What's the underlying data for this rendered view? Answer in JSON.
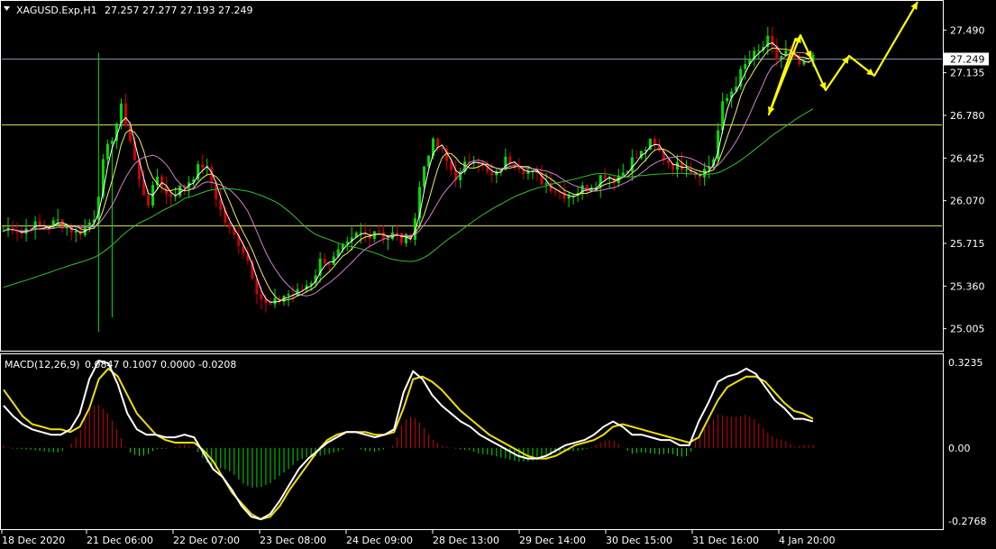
{
  "header": {
    "symbol": "XAGUSD.Exp,H1",
    "ohlc": "27.257 27.277 27.193 27.249"
  },
  "indicator": {
    "title": "MACD(12,26,9)",
    "values": "0.0847 0.1007 0.0000 -0.0208"
  },
  "colors": {
    "background": "#000000",
    "bull": "#00e000",
    "bear": "#d00000",
    "ma_white": "#ffffff",
    "ma_yellow": "#f0f060",
    "ma_violet": "#d080d0",
    "ma_green": "#30c030",
    "level_line": "#e0e060",
    "arrow": "#ffff00",
    "current_price_line": "#7f93a8"
  },
  "chart_data": [
    {
      "type": "candlestick",
      "title": "XAGUSD.Exp,H1",
      "y_ticks": [
        "27.490",
        "27.135",
        "26.780",
        "26.425",
        "26.070",
        "25.715",
        "25.360",
        "25.005"
      ],
      "ylim": [
        24.95,
        27.65
      ],
      "current_price": "27.249",
      "x_ticks": [
        "18 Dec 2020",
        "21 Dec 06:00",
        "22 Dec 07:00",
        "23 Dec 08:00",
        "24 Dec 09:00",
        "28 Dec 13:00",
        "29 Dec 14:00",
        "30 Dec 15:00",
        "31 Dec 16:00",
        "4 Jan 20:00"
      ],
      "horizontal_levels": [
        26.7,
        25.86
      ],
      "close_path": [
        25.82,
        25.86,
        25.8,
        25.88,
        25.84,
        25.86,
        25.9,
        25.86,
        25.8,
        25.84,
        25.95,
        26.4,
        26.62,
        26.85,
        26.55,
        26.2,
        26.05,
        26.3,
        26.1,
        26.15,
        26.2,
        26.3,
        26.38,
        26.2,
        25.95,
        25.8,
        25.72,
        25.55,
        25.3,
        25.18,
        25.22,
        25.3,
        25.28,
        25.35,
        25.42,
        25.6,
        25.55,
        25.65,
        25.7,
        25.8,
        25.78,
        25.85,
        25.75,
        25.8,
        25.72,
        25.82,
        26.3,
        26.55,
        26.5,
        26.35,
        26.25,
        26.4,
        26.45,
        26.3,
        26.25,
        26.4,
        26.42,
        26.35,
        26.3,
        26.25,
        26.2,
        26.15,
        26.12,
        26.15,
        26.18,
        26.22,
        26.3,
        26.25,
        26.3,
        26.4,
        26.45,
        26.55,
        26.48,
        26.4,
        26.35,
        26.38,
        26.3,
        26.32,
        26.4,
        26.85,
        26.98,
        27.12,
        27.25,
        27.3,
        27.4,
        27.25,
        27.3,
        27.22,
        27.18,
        27.25
      ],
      "projection_arrows": [
        [
          [
            883,
            42
          ],
          [
            853,
            127
          ],
          [
            888,
            39
          ],
          [
            900,
            65
          ],
          [
            916,
            100
          ],
          [
            942,
            62
          ],
          [
            970,
            84
          ],
          [
            1018,
            2
          ]
        ]
      ]
    },
    {
      "type": "macd",
      "title": "MACD(12,26,9)",
      "y_ticks": [
        "0.3235",
        "0.00",
        "-0.2768"
      ],
      "ylim": [
        -0.2768,
        0.3235
      ],
      "macd_main": [
        0.16,
        0.12,
        0.09,
        0.07,
        0.06,
        0.05,
        0.05,
        0.07,
        0.13,
        0.26,
        0.33,
        0.32,
        0.24,
        0.13,
        0.07,
        0.05,
        0.05,
        0.04,
        0.04,
        0.05,
        0.04,
        -0.02,
        -0.08,
        -0.11,
        -0.16,
        -0.22,
        -0.26,
        -0.27,
        -0.25,
        -0.2,
        -0.14,
        -0.08,
        -0.04,
        -0.01,
        0.02,
        0.04,
        0.06,
        0.06,
        0.05,
        0.04,
        0.05,
        0.07,
        0.21,
        0.29,
        0.26,
        0.2,
        0.16,
        0.13,
        0.1,
        0.08,
        0.05,
        0.03,
        0.01,
        -0.01,
        -0.03,
        -0.04,
        -0.04,
        -0.03,
        -0.01,
        0.01,
        0.02,
        0.03,
        0.05,
        0.08,
        0.1,
        0.08,
        0.05,
        0.05,
        0.04,
        0.03,
        0.03,
        0.01,
        0.01,
        0.1,
        0.17,
        0.25,
        0.27,
        0.28,
        0.3,
        0.28,
        0.23,
        0.18,
        0.15,
        0.11,
        0.11,
        0.1
      ],
      "macd_signal": [
        0.22,
        0.17,
        0.12,
        0.09,
        0.08,
        0.07,
        0.07,
        0.06,
        0.08,
        0.15,
        0.26,
        0.3,
        0.27,
        0.2,
        0.13,
        0.09,
        0.05,
        0.03,
        0.02,
        0.02,
        0.02,
        -0.01,
        -0.05,
        -0.11,
        -0.17,
        -0.21,
        -0.25,
        -0.27,
        -0.26,
        -0.22,
        -0.16,
        -0.11,
        -0.06,
        -0.01,
        0.03,
        0.05,
        0.06,
        0.06,
        0.06,
        0.05,
        0.05,
        0.06,
        0.15,
        0.26,
        0.27,
        0.25,
        0.22,
        0.18,
        0.14,
        0.11,
        0.08,
        0.05,
        0.03,
        0.01,
        -0.01,
        -0.03,
        -0.04,
        -0.04,
        -0.03,
        -0.01,
        0.01,
        0.02,
        0.03,
        0.05,
        0.08,
        0.09,
        0.08,
        0.07,
        0.06,
        0.05,
        0.04,
        0.03,
        0.02,
        0.04,
        0.11,
        0.18,
        0.23,
        0.25,
        0.27,
        0.27,
        0.25,
        0.21,
        0.17,
        0.14,
        0.13,
        0.11
      ]
    }
  ]
}
